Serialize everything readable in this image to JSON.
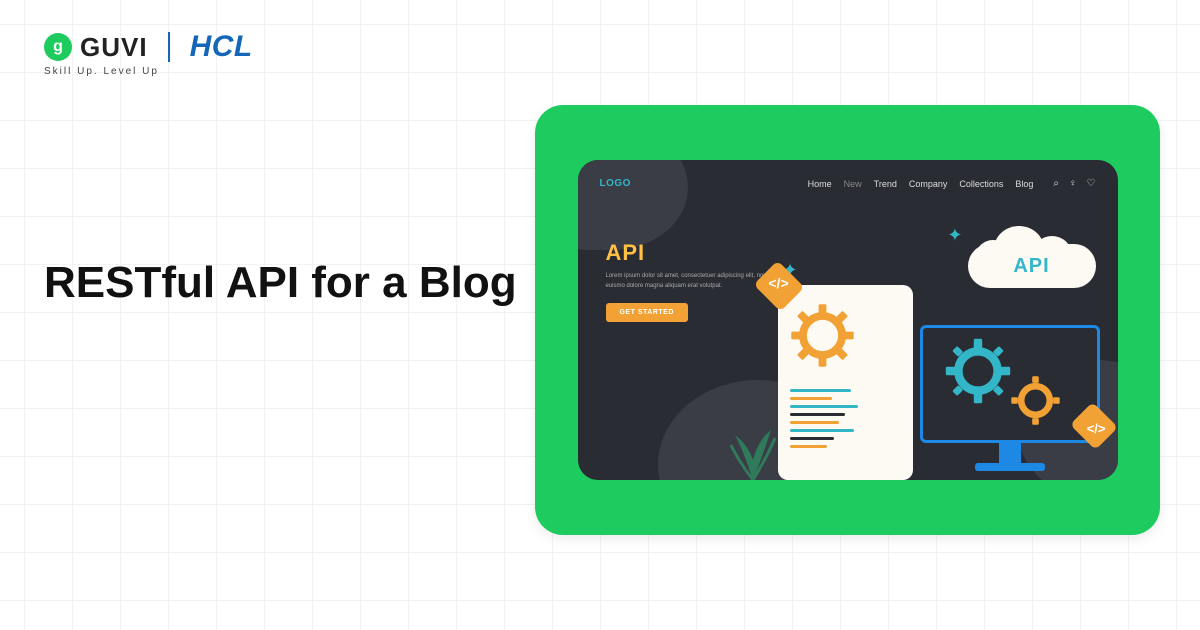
{
  "header": {
    "guvi": "GUVI",
    "hcl": "HCL",
    "tagline": "Skill Up. Level Up"
  },
  "title": "RESTful API for a Blog",
  "colors": {
    "accent": "#1ecb5e",
    "dark": "#2a2c33",
    "orange": "#f2a235",
    "teal": "#34b6c9",
    "blue": "#1e88e5"
  },
  "mock": {
    "logo": "LOGO",
    "nav": [
      "Home",
      "New",
      "Trend",
      "Company",
      "Collections",
      "Blog"
    ],
    "nav_active_index": 1,
    "hero_title": "API",
    "hero_desc": "Lorem ipsum dolor sit amet, consectetuer adipiscing elit, nonummy euismo dolore magna aliquam erat volutpat.",
    "cta": "GET STARTED",
    "cloud_label": "API"
  }
}
